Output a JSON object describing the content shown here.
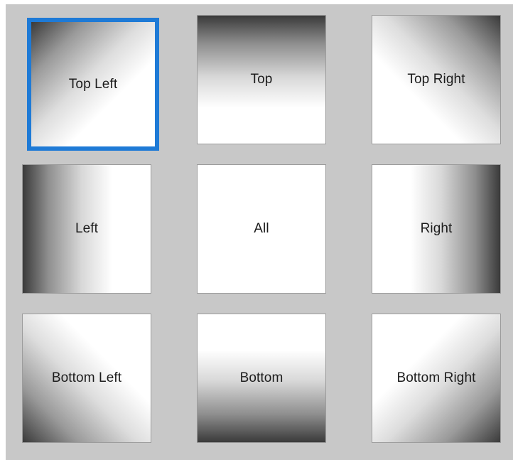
{
  "grid": {
    "selected": "top-left",
    "selection_color": "#1e7ad6",
    "tiles": [
      {
        "id": "top-left",
        "label": "Top Left"
      },
      {
        "id": "top",
        "label": "Top"
      },
      {
        "id": "top-right",
        "label": "Top Right"
      },
      {
        "id": "left",
        "label": "Left"
      },
      {
        "id": "all",
        "label": "All"
      },
      {
        "id": "right",
        "label": "Right"
      },
      {
        "id": "bottom-left",
        "label": "Bottom Left"
      },
      {
        "id": "bottom",
        "label": "Bottom"
      },
      {
        "id": "bottom-right",
        "label": "Bottom Right"
      }
    ]
  }
}
